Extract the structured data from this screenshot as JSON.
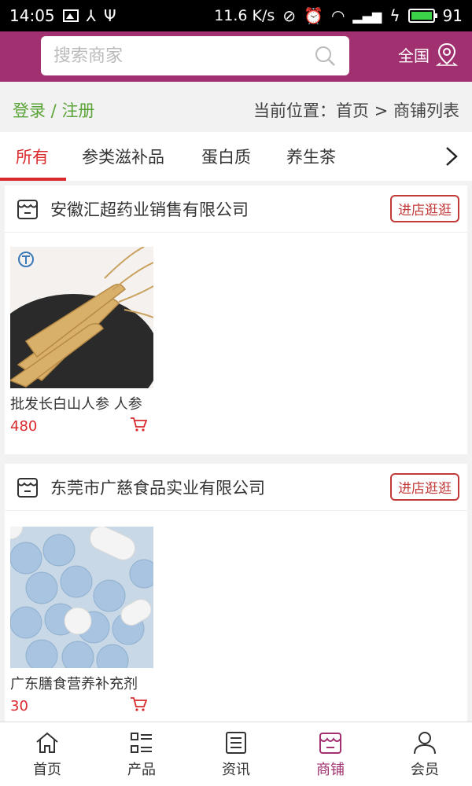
{
  "status_bar": {
    "time": "14:05",
    "network_speed": "11.6 K/s",
    "battery_level": "91"
  },
  "header": {
    "search_placeholder": "搜索商家",
    "region_label": "全国"
  },
  "breadcrumb": {
    "login": "登录 / 注册",
    "location": "当前位置：首页 > 商铺列表"
  },
  "tabs": [
    {
      "label": "所有",
      "active": true
    },
    {
      "label": "参类滋补品",
      "active": false
    },
    {
      "label": "蛋白质",
      "active": false
    },
    {
      "label": "养生茶",
      "active": false
    }
  ],
  "shops": [
    {
      "name": "安徽汇超药业销售有限公司",
      "visit_label": "进店逛逛",
      "product": {
        "name": "批发长白山人参 人参",
        "price": "480",
        "image": "ginseng-roots"
      }
    },
    {
      "name": "东莞市广慈食品实业有限公司",
      "visit_label": "进店逛逛",
      "product": {
        "name": "广东膳食营养补充剂",
        "price": "30",
        "image": "blue-white-tablets"
      }
    }
  ],
  "bottom_nav": [
    {
      "label": "首页",
      "icon": "home-icon",
      "active": false
    },
    {
      "label": "产品",
      "icon": "grid-list-icon",
      "active": false
    },
    {
      "label": "资讯",
      "icon": "news-icon",
      "active": false
    },
    {
      "label": "商铺",
      "icon": "shop-icon",
      "active": true
    },
    {
      "label": "会员",
      "icon": "user-icon",
      "active": false
    }
  ],
  "colors": {
    "brand": "#a0306f",
    "accent_red": "#d9292c",
    "login_green": "#5aa437"
  }
}
